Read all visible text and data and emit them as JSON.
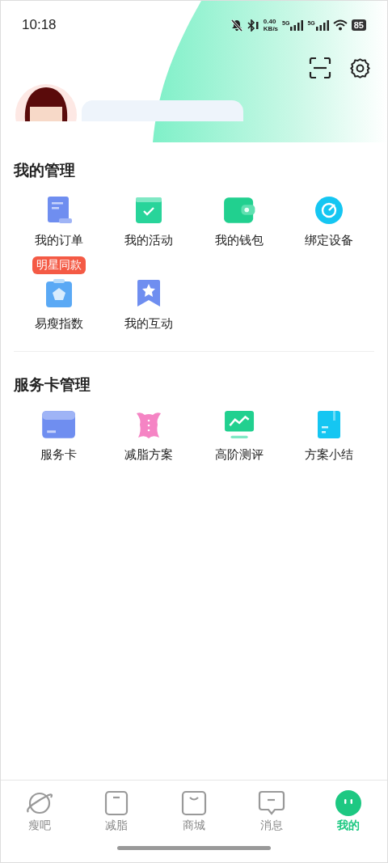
{
  "status_bar": {
    "time": "10:18",
    "net_speed": "0.40",
    "net_unit": "KB/s",
    "signal_1": "5G",
    "signal_2": "5G",
    "battery": "85"
  },
  "sections": [
    {
      "title": "我的管理",
      "items": [
        {
          "label": "我的订单"
        },
        {
          "label": "我的活动"
        },
        {
          "label": "我的钱包"
        },
        {
          "label": "绑定设备"
        },
        {
          "label": "易瘦指数",
          "badge": "明星同款"
        },
        {
          "label": "我的互动"
        }
      ]
    },
    {
      "title": "服务卡管理",
      "items": [
        {
          "label": "服务卡"
        },
        {
          "label": "减脂方案"
        },
        {
          "label": "高阶测评"
        },
        {
          "label": "方案小结"
        }
      ]
    }
  ],
  "tab_bar": [
    {
      "label": "瘦吧",
      "selected": false
    },
    {
      "label": "减脂",
      "selected": false
    },
    {
      "label": "商城",
      "selected": false
    },
    {
      "label": "消息",
      "selected": false
    },
    {
      "label": "我的",
      "selected": true
    }
  ]
}
